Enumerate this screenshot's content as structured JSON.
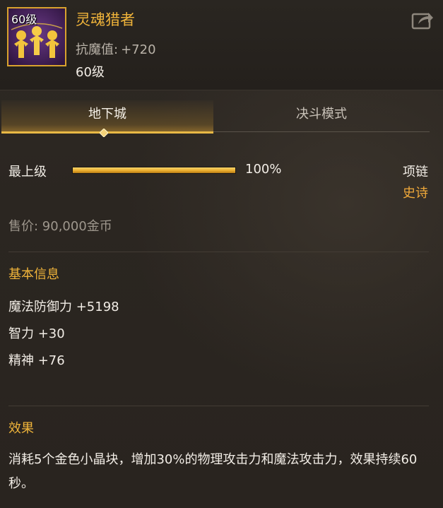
{
  "header": {
    "icon_level": "60级",
    "name": "灵魂猎者",
    "stat_label": "抗魔值:",
    "stat_value": "+720",
    "level": "60级"
  },
  "tabs": [
    {
      "label": "地下城",
      "active": true
    },
    {
      "label": "决斗模式",
      "active": false
    }
  ],
  "grade": {
    "label": "最上级",
    "percent_text": "100%",
    "fill_fraction": 1.0
  },
  "item_type": "项链",
  "rarity": "史诗",
  "price": "售价: 90,000金币",
  "basic_info": {
    "title": "基本信息",
    "stats": [
      "魔法防御力 +5198",
      "智力 +30",
      "精神 +76"
    ]
  },
  "effect": {
    "title": "效果",
    "text": "消耗5个金色小晶块，增加30%的物理攻击力和魔法攻击力，效果持续60秒。"
  },
  "colors": {
    "accent_gold": "#f0b43a",
    "rarity_epic": "#f0a93a",
    "tab_underline": "#e8b845"
  },
  "icons": {
    "share": "share-icon",
    "tab_marker": "diamond-marker-icon"
  }
}
